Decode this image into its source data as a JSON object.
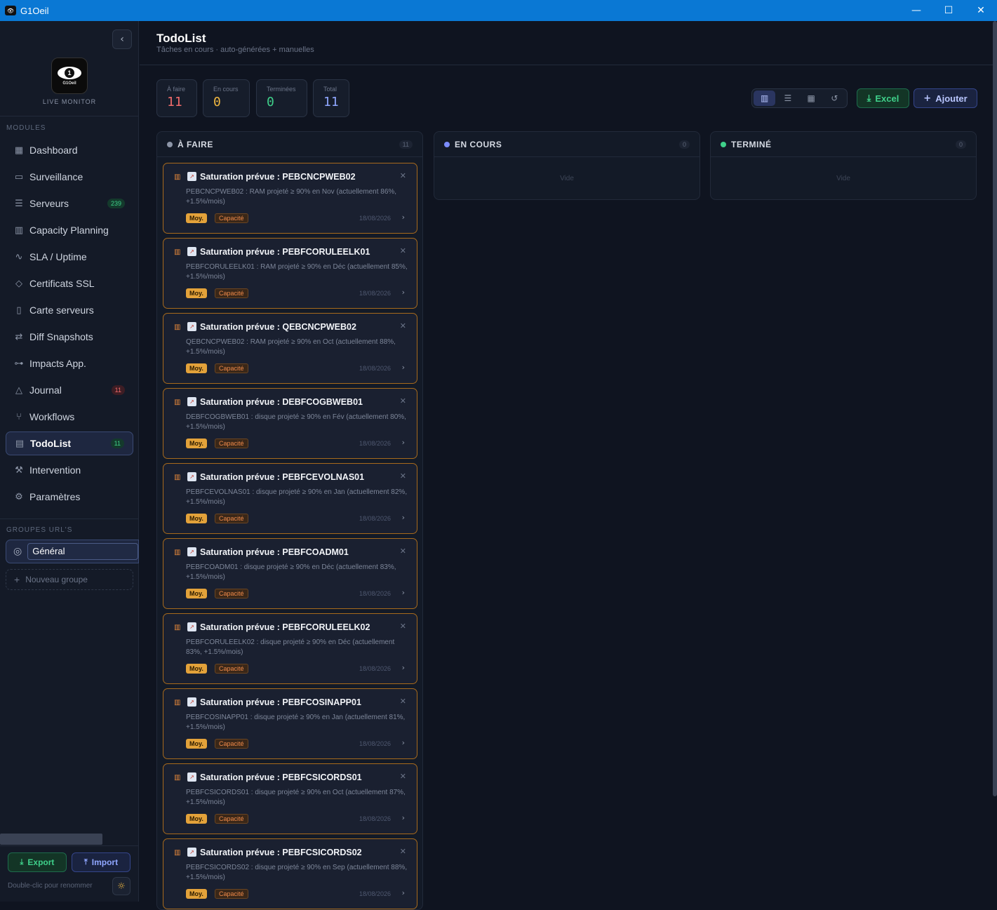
{
  "window": {
    "title": "G1Oeil",
    "icon": "app-icon"
  },
  "brand": {
    "logo_text": "G1Oeil",
    "subtitle": "LIVE MONITOR"
  },
  "sidebar": {
    "modules_label": "MODULES",
    "items": [
      {
        "label": "Dashboard",
        "icon": "dashboard-icon"
      },
      {
        "label": "Surveillance",
        "icon": "monitor-icon"
      },
      {
        "label": "Serveurs",
        "icon": "server-icon",
        "badge": "239"
      },
      {
        "label": "Capacity Planning",
        "icon": "chart-icon"
      },
      {
        "label": "SLA / Uptime",
        "icon": "pulse-icon"
      },
      {
        "label": "Certificats SSL",
        "icon": "shield-icon"
      },
      {
        "label": "Carte serveurs",
        "icon": "map-icon"
      },
      {
        "label": "Diff Snapshots",
        "icon": "diff-icon"
      },
      {
        "label": "Impacts App.",
        "icon": "network-icon"
      },
      {
        "label": "Journal",
        "icon": "warning-icon",
        "badge": "11"
      },
      {
        "label": "Workflows",
        "icon": "workflow-icon"
      },
      {
        "label": "TodoList",
        "icon": "clipboard-icon",
        "badge": "11"
      },
      {
        "label": "Intervention",
        "icon": "wrench-icon"
      },
      {
        "label": "Paramètres",
        "icon": "gear-icon"
      }
    ],
    "groups_label": "GROUPES URL'S",
    "group_name": "Général",
    "new_group": "Nouveau groupe",
    "export_label": "Export",
    "import_label": "Import",
    "hint": "Double-clic pour renommer"
  },
  "header": {
    "title": "TodoList",
    "subtitle": "Tâches en cours · auto-générées + manuelles"
  },
  "stats": [
    {
      "label": "À faire",
      "value": "11",
      "color": "#f06b6b"
    },
    {
      "label": "En cours",
      "value": "0",
      "color": "#f0b740"
    },
    {
      "label": "Terminées",
      "value": "0",
      "color": "#3fd08a"
    },
    {
      "label": "Total",
      "value": "11",
      "color": "#8fa6ff"
    }
  ],
  "toolbar": {
    "excel_label": "Excel",
    "add_label": "Ajouter"
  },
  "columns": [
    {
      "title": "À FAIRE",
      "count": "11",
      "color": "#8d96a8"
    },
    {
      "title": "EN COURS",
      "count": "0",
      "color": "#7b8cff",
      "empty": "Vide"
    },
    {
      "title": "TERMINÉ",
      "count": "0",
      "color": "#3fd08a",
      "empty": "Vide"
    }
  ],
  "cards": [
    {
      "title": "Saturation prévue : PEBCNCPWEB02",
      "desc": "PEBCNCPWEB02 : RAM projeté ≥ 90% en Nov (actuellement 86%, +1.5%/mois)",
      "priority": "Moy.",
      "category": "Capacité",
      "date": "18/08/2026"
    },
    {
      "title": "Saturation prévue : PEBFCORULEELK01",
      "desc": "PEBFCORULEELK01 : RAM projeté ≥ 90% en Déc (actuellement 85%, +1.5%/mois)",
      "priority": "Moy.",
      "category": "Capacité",
      "date": "18/08/2026"
    },
    {
      "title": "Saturation prévue : QEBCNCPWEB02",
      "desc": "QEBCNCPWEB02 : RAM projeté ≥ 90% en Oct (actuellement 88%, +1.5%/mois)",
      "priority": "Moy.",
      "category": "Capacité",
      "date": "18/08/2026"
    },
    {
      "title": "Saturation prévue : DEBFCOGBWEB01",
      "desc": "DEBFCOGBWEB01 : disque projeté ≥ 90% en Fév (actuellement 80%, +1.5%/mois)",
      "priority": "Moy.",
      "category": "Capacité",
      "date": "18/08/2026"
    },
    {
      "title": "Saturation prévue : PEBFCEVOLNAS01",
      "desc": "PEBFCEVOLNAS01 : disque projeté ≥ 90% en Jan (actuellement 82%, +1.5%/mois)",
      "priority": "Moy.",
      "category": "Capacité",
      "date": "18/08/2026"
    },
    {
      "title": "Saturation prévue : PEBFCOADM01",
      "desc": "PEBFCOADM01 : disque projeté ≥ 90% en Déc (actuellement 83%, +1.5%/mois)",
      "priority": "Moy.",
      "category": "Capacité",
      "date": "18/08/2026"
    },
    {
      "title": "Saturation prévue : PEBFCORULEELK02",
      "desc": "PEBFCORULEELK02 : disque projeté ≥ 90% en Déc (actuellement 83%, +1.5%/mois)",
      "priority": "Moy.",
      "category": "Capacité",
      "date": "18/08/2026"
    },
    {
      "title": "Saturation prévue : PEBFCOSINAPP01",
      "desc": "PEBFCOSINAPP01 : disque projeté ≥ 90% en Jan (actuellement 81%, +1.5%/mois)",
      "priority": "Moy.",
      "category": "Capacité",
      "date": "18/08/2026"
    },
    {
      "title": "Saturation prévue : PEBFCSICORDS01",
      "desc": "PEBFCSICORDS01 : disque projeté ≥ 90% en Oct (actuellement 87%, +1.5%/mois)",
      "priority": "Moy.",
      "category": "Capacité",
      "date": "18/08/2026"
    },
    {
      "title": "Saturation prévue : PEBFCSICORDS02",
      "desc": "PEBFCSICORDS02 : disque projeté ≥ 90% en Sep (actuellement 88%, +1.5%/mois)",
      "priority": "Moy.",
      "category": "Capacité",
      "date": "18/08/2026"
    }
  ]
}
